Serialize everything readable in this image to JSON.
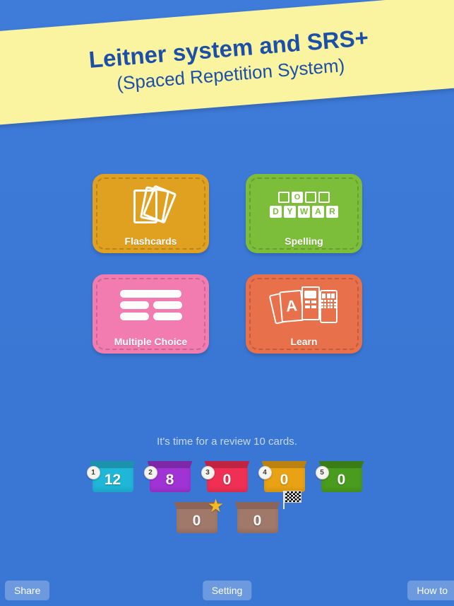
{
  "banner": {
    "title": "Leitner system and SRS+",
    "subtitle": "(Spaced Repetition System)"
  },
  "colors": {
    "background": "#3c7ad8",
    "banner_bg": "#faf3a0",
    "banner_text": "#1c4fa8",
    "flashcards": "#e0a020",
    "spelling": "#7cbe3a",
    "multiple_choice": "#f27bb0",
    "learn": "#e8704a"
  },
  "modes": [
    {
      "label": "Flashcards",
      "icon": "flashcards-stack-icon"
    },
    {
      "label": "Spelling",
      "icon": "spelling-tiles-icon"
    },
    {
      "label": "Multiple Choice",
      "icon": "multiple-choice-bars-icon"
    },
    {
      "label": "Learn",
      "icon": "learn-cards-keypad-icon"
    }
  ],
  "spelling_icon": {
    "slots": [
      "",
      "O",
      "",
      ""
    ],
    "tiles": [
      "D",
      "Y",
      "W",
      "A",
      "R"
    ]
  },
  "learn_icon": {
    "card_letter": "A"
  },
  "review": {
    "message": "It's time for a review 10 cards."
  },
  "leitner_boxes": [
    {
      "number": "1",
      "count": "12",
      "color": "#1fb6d8",
      "rim": "#1b93ad",
      "badge": true
    },
    {
      "number": "2",
      "count": "8",
      "color": "#a033d4",
      "rim": "#7d28a6",
      "badge": true
    },
    {
      "number": "3",
      "count": "0",
      "color": "#ef3054",
      "rim": "#c02442",
      "badge": true
    },
    {
      "number": "4",
      "count": "0",
      "color": "#e8a213",
      "rim": "#bb8210",
      "badge": true
    },
    {
      "number": "5",
      "count": "0",
      "color": "#4a9c1e",
      "rim": "#3a7d18",
      "badge": true
    }
  ],
  "special_boxes": [
    {
      "count": "0",
      "color": "#a1796a",
      "rim": "#8c6558",
      "marker": "star-icon"
    },
    {
      "count": "0",
      "color": "#a1796a",
      "rim": "#8c6558",
      "marker": "checkered-flag-icon"
    }
  ],
  "bottom_bar": {
    "share": "Share",
    "setting": "Setting",
    "howto": "How to"
  }
}
